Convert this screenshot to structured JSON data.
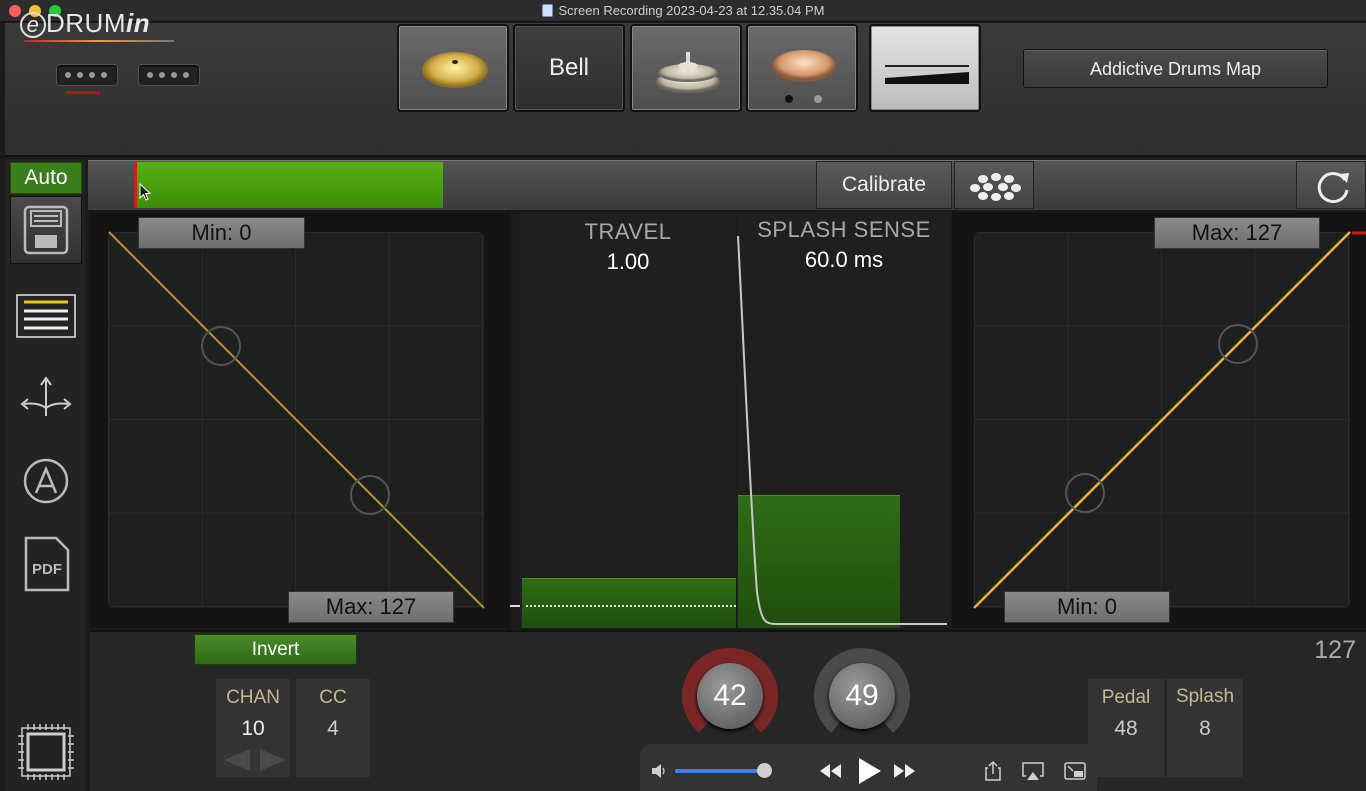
{
  "window": {
    "title": "Screen Recording 2023-04-23 at 12.35.04 PM"
  },
  "header": {
    "logo": {
      "e": "e",
      "drum": "DRUM",
      "in": "in"
    },
    "pads": [
      {
        "name": "cymbal-bow"
      },
      {
        "name": "bell",
        "label": "Bell"
      },
      {
        "name": "hihat"
      },
      {
        "name": "cymbal-crash"
      },
      {
        "name": "pedal"
      }
    ],
    "map_button": "Addictive Drums Map",
    "page_dots": {
      "count": 2,
      "active": 0
    }
  },
  "sidebar": {
    "auto_label": "Auto",
    "icons": [
      "save-icon",
      "list-icon",
      "arrows-icon",
      "a-circle-icon",
      "pdf-icon",
      "chip-icon"
    ]
  },
  "toolbar": {
    "level_fraction": 0.25,
    "calibrate_label": "Calibrate",
    "dots_icon": "dots-pattern-icon",
    "refresh_icon": "refresh-icon"
  },
  "curve_left": {
    "min_label": "Min: 0",
    "max_label": "Max: 127",
    "color": "#b8952a"
  },
  "curve_right": {
    "max_label": "Max: 127",
    "min_label": "Min: 0",
    "color": "#f0b23a"
  },
  "travel": {
    "title": "TRAVEL",
    "value": "1.00",
    "level_fraction": 0.12
  },
  "splash": {
    "title": "SPLASH SENSE",
    "value": "60.0 ms",
    "level_fraction": 0.32
  },
  "bottom": {
    "invert_label": "Invert",
    "chan": {
      "label": "CHAN",
      "value": "10"
    },
    "cc": {
      "label": "CC",
      "value": "4"
    },
    "readout": "127",
    "knob_a": {
      "value": "42",
      "ring": "#7a2626"
    },
    "knob_b": {
      "value": "49",
      "ring": "#4a4a4a"
    },
    "pedal": {
      "label": "Pedal",
      "value": "48"
    },
    "splash": {
      "label": "Splash",
      "value": "8"
    }
  },
  "player": {
    "volume_fraction": 0.97
  }
}
